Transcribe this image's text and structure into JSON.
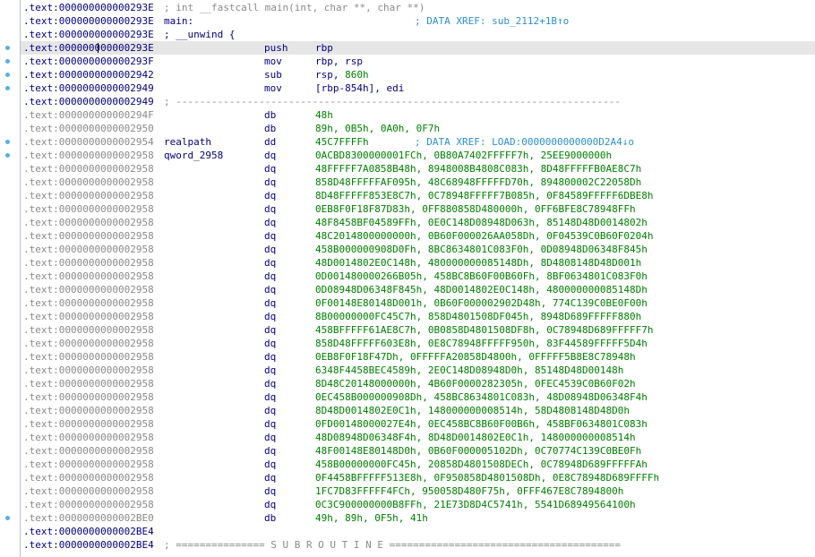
{
  "rows": [
    {
      "addr": ".text:000000000000293E",
      "kind": "code",
      "full": "; int __fastcall main(int, char **, char **)",
      "full_color": "#8a8a8a"
    },
    {
      "addr": ".text:000000000000293E",
      "kind": "code",
      "label": "main:",
      "xref": "; DATA XREF: sub_2112+1B↑o"
    },
    {
      "addr": ".text:000000000000293E",
      "kind": "code",
      "full": "; __unwind {",
      "full_color": "#000080"
    },
    {
      "addr": ".text:000000000000293E",
      "kind": "code",
      "mnem": "push",
      "op_reg": "rbp",
      "selected": true,
      "caret": true
    },
    {
      "addr": ".text:000000000000293F",
      "kind": "code",
      "mnem": "mov",
      "op_reg": "rbp, rsp"
    },
    {
      "addr": ".text:0000000000002942",
      "kind": "code",
      "mnem": "sub",
      "op_reg": "rsp, ",
      "op_num": "860h"
    },
    {
      "addr": ".text:0000000000002949",
      "kind": "code",
      "mnem": "mov",
      "op_reg": "[rbp-854h], edi"
    },
    {
      "addr": ".text:0000000000002949",
      "kind": "code",
      "full": "; ---------------------------------------------------------------------------",
      "full_color": "#8a8a8a"
    },
    {
      "addr": ".text:000000000000294F",
      "kind": "data",
      "mnem": "db",
      "op_num": "48h"
    },
    {
      "addr": ".text:0000000000002950",
      "kind": "data",
      "mnem": "db",
      "op_num": "89h, 0B5h, 0A0h, 0F7h"
    },
    {
      "addr": ".text:0000000000002954",
      "kind": "data",
      "label": "realpath",
      "mnem": "dd",
      "op_num": "45C7FFFFh",
      "xref": "; DATA XREF: LOAD:0000000000000D2A4↓o"
    },
    {
      "addr": ".text:0000000000002958",
      "kind": "data",
      "label": "qword_2958",
      "mnem": "dq",
      "op_num": "0ACBD8300000001FCh, 0B80A7402FFFFF7h, 25EE9000000h"
    },
    {
      "addr": ".text:0000000000002958",
      "kind": "data",
      "mnem": "dq",
      "op_num": "48FFFFF7A0858B48h, 8948008B4808C083h, 8D48FFFFFB0AE8C7h"
    },
    {
      "addr": ".text:0000000000002958",
      "kind": "data",
      "mnem": "dq",
      "op_num": "858D48FFFFFAF095h, 48C68948FFFFFD70h, 894800002C22058Dh"
    },
    {
      "addr": ".text:0000000000002958",
      "kind": "data",
      "mnem": "dq",
      "op_num": "8D48FFFFF853E8C7h, 0C78948FFFFF7B085h, 0F84589FFFFF6DBE8h"
    },
    {
      "addr": ".text:0000000000002958",
      "kind": "data",
      "mnem": "dq",
      "op_num": "0EB8F0F18F87D83h, 0FF880858D480000h, 0FF6BFE8C78948FFh"
    },
    {
      "addr": ".text:0000000000002958",
      "kind": "data",
      "mnem": "dq",
      "op_num": "48F8458BF04589FFh, 0E0C148D08948D063h, 85148D48D0014802h"
    },
    {
      "addr": ".text:0000000000002958",
      "kind": "data",
      "mnem": "dq",
      "op_num": "48C2014800000000h, 0B60F000026AA058Dh, 0F04539C0B60F0204h"
    },
    {
      "addr": ".text:0000000000002958",
      "kind": "data",
      "mnem": "dq",
      "op_num": "458B000000908D0Fh, 8BC8634801C083F0h, 0D08948D06348F845h"
    },
    {
      "addr": ".text:0000000000002958",
      "kind": "data",
      "mnem": "dq",
      "op_num": "48D0014802E0C148h, 480000000085148Dh, 8D4808148D48D001h"
    },
    {
      "addr": ".text:0000000000002958",
      "kind": "data",
      "mnem": "dq",
      "op_num": "0D001480000266B05h, 458BC8B60F00B60Fh, 8BF0634801C083F0h"
    },
    {
      "addr": ".text:0000000000002958",
      "kind": "data",
      "mnem": "dq",
      "op_num": "0D08948D06348F845h, 48D0014802E0C148h, 480000000085148Dh"
    },
    {
      "addr": ".text:0000000000002958",
      "kind": "data",
      "mnem": "dq",
      "op_num": "0F00148E80148D001h, 0B60F000002902D48h, 774C139C0BE0F00h"
    },
    {
      "addr": ".text:0000000000002958",
      "kind": "data",
      "mnem": "dq",
      "op_num": "8B00000000FC45C7h, 858D4801508DF045h, 8948D689FFFFF880h"
    },
    {
      "addr": ".text:0000000000002958",
      "kind": "data",
      "mnem": "dq",
      "op_num": "458BFFFFF61AE8C7h, 0B0858D4801508DF8h, 0C78948D689FFFFF7h"
    },
    {
      "addr": ".text:0000000000002958",
      "kind": "data",
      "mnem": "dq",
      "op_num": "858D48FFFFF603E8h, 0E8C78948FFFFF950h, 83F44589FFFFF5D4h"
    },
    {
      "addr": ".text:0000000000002958",
      "kind": "data",
      "mnem": "dq",
      "op_num": "0EB8F0F18F47Dh, 0FFFFFA20858D4800h, 0FFFFF5B8E8C78948h"
    },
    {
      "addr": ".text:0000000000002958",
      "kind": "data",
      "mnem": "dq",
      "op_num": "6348F4458BEC4589h, 2E0C148D08948D0h, 85148D48D00148h"
    },
    {
      "addr": ".text:0000000000002958",
      "kind": "data",
      "mnem": "dq",
      "op_num": "8D48C20148000000h, 4B60F0000282305h, 0FEC4539C0B60F02h"
    },
    {
      "addr": ".text:0000000000002958",
      "kind": "data",
      "mnem": "dq",
      "op_num": "0EC458B000000908Dh, 458BC8634801C083h, 48D08948D06348F4h"
    },
    {
      "addr": ".text:0000000000002958",
      "kind": "data",
      "mnem": "dq",
      "op_num": "8D48D0014802E0C1h, 148000000008514h, 58D4808148D48D0h"
    },
    {
      "addr": ".text:0000000000002958",
      "kind": "data",
      "mnem": "dq",
      "op_num": "0FD00148000027E4h, 0EC458BC8B60F00B6h, 458BF0634801C083h"
    },
    {
      "addr": ".text:0000000000002958",
      "kind": "data",
      "mnem": "dq",
      "op_num": "48D08948D06348F4h, 8D48D0014802E0C1h, 148000000008514h"
    },
    {
      "addr": ".text:0000000000002958",
      "kind": "data",
      "mnem": "dq",
      "op_num": "48F00148E80148D0h, 0B60F000005102Dh, 0C70774C139C0BE0Fh"
    },
    {
      "addr": ".text:0000000000002958",
      "kind": "data",
      "mnem": "dq",
      "op_num": "458B00000000FC45h, 20858D4801508DECh, 0C78948D689FFFFFAh"
    },
    {
      "addr": ".text:0000000000002958",
      "kind": "data",
      "mnem": "dq",
      "op_num": "0F4458BFFFFF513E8h, 0F950858D4801508Dh, 0E8C78948D689FFFFh"
    },
    {
      "addr": ".text:0000000000002958",
      "kind": "data",
      "mnem": "dq",
      "op_num": "1FC7D83FFFFF4FCh, 950058D480F75h, 0FFF467E8C7894800h"
    },
    {
      "addr": ".text:0000000000002958",
      "kind": "data",
      "mnem": "dq",
      "op_num": "0C3C900000000B8FFh, 21E73D8D4C5741h, 5541D68949564100h"
    },
    {
      "addr": ".text:0000000000002BE0",
      "kind": "data",
      "mnem": "db",
      "op_num": "49h, 89h, 0F5h, 41h"
    },
    {
      "addr": ".text:0000000000002BE4",
      "kind": "code"
    },
    {
      "addr": ".text:0000000000002BE4",
      "kind": "code",
      "full": "; =============== S U B R O U T I N E =======================================",
      "full_color": "#8a8a8a"
    }
  ],
  "gutter_dots": [
    3,
    4,
    5,
    6,
    10,
    11,
    38
  ],
  "colors": {
    "code_address": "#000080",
    "data_address": "#8a8a8a",
    "numeric": "#008000",
    "comment": "#8a8a8a",
    "xref": "#2d8fcf",
    "selection": "#e6e6e6",
    "gutter_dot": "#5aaee6"
  }
}
